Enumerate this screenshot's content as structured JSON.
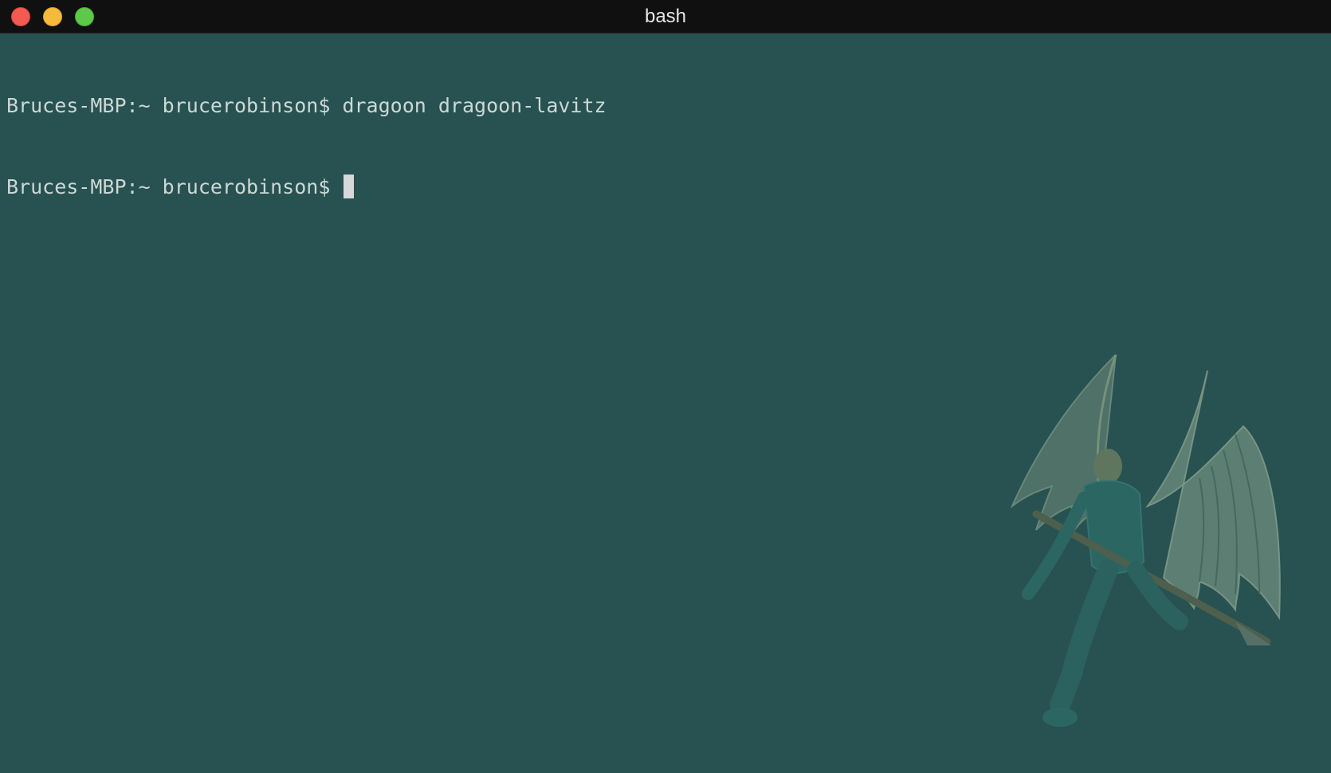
{
  "window": {
    "title": "bash"
  },
  "terminal": {
    "lines": [
      {
        "prompt": "Bruces-MBP:~ brucerobinson$",
        "command": "dragoon dragoon-lavitz"
      },
      {
        "prompt": "Bruces-MBP:~ brucerobinson$",
        "command": ""
      }
    ]
  },
  "colors": {
    "background": "#285251",
    "titlebar": "#101010",
    "text": "#cbd8d6",
    "close": "#f25a52",
    "minimize": "#f6bb3a",
    "maximize": "#5ec84a"
  },
  "background_image": {
    "icon": "winged-knight-artwork"
  }
}
